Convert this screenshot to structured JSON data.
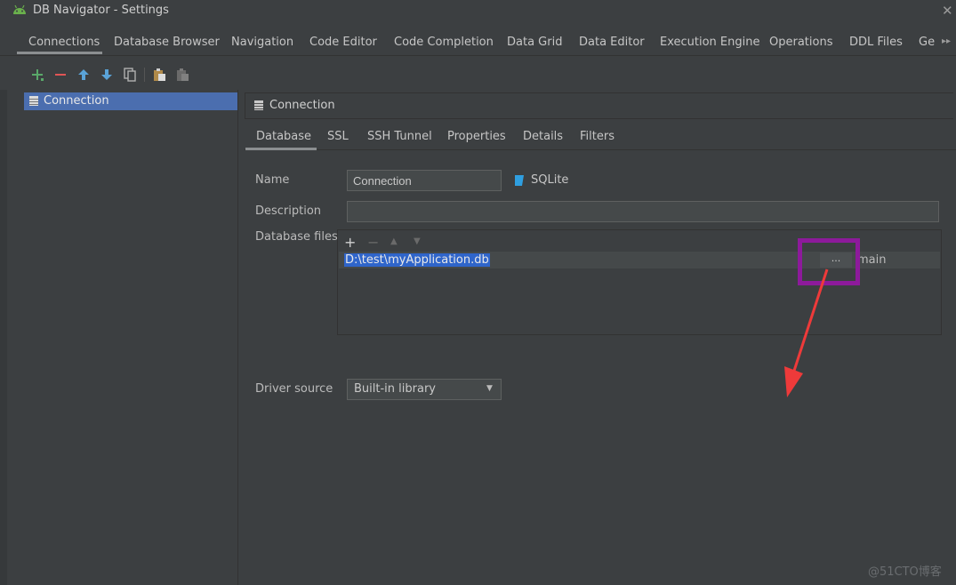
{
  "window": {
    "title": "DB Navigator - Settings"
  },
  "top_tabs": [
    {
      "label": "Connections"
    },
    {
      "label": "Database Browser"
    },
    {
      "label": "Navigation"
    },
    {
      "label": "Code Editor"
    },
    {
      "label": "Code Completion"
    },
    {
      "label": "Data Grid"
    },
    {
      "label": "Data Editor"
    },
    {
      "label": "Execution Engine"
    },
    {
      "label": "Operations"
    },
    {
      "label": "DDL Files"
    },
    {
      "label": "Ge"
    }
  ],
  "selected_top_tab": "Connections",
  "toolbar": {
    "icons": [
      "add-icon",
      "remove-icon",
      "move-up-icon",
      "move-down-icon",
      "copy-icon",
      "paste-icon",
      "delete-icon"
    ]
  },
  "connections": [
    {
      "label": "Connection"
    }
  ],
  "panel": {
    "title": "Connection",
    "sub_tabs": [
      {
        "label": "Database"
      },
      {
        "label": "SSL"
      },
      {
        "label": "SSH Tunnel"
      },
      {
        "label": "Properties"
      },
      {
        "label": "Details"
      },
      {
        "label": "Filters"
      }
    ],
    "selected_sub_tab": "Database"
  },
  "form": {
    "name_label": "Name",
    "name_value": "Connection",
    "db_type": "SQLite",
    "description_label": "Description",
    "description_value": "",
    "database_files_label": "Database files",
    "file_path": "D:\\test\\myApplication.db",
    "browse_label": "...",
    "schema_name": "main",
    "driver_source_label": "Driver source",
    "driver_source_value": "Built-in library"
  },
  "annotation": {
    "highlight_color": "#8d1a9b",
    "arrow_color": "#ee3a3a"
  },
  "watermark": "@51CTO博客",
  "colors": {
    "selection": "#4b6eaf",
    "text_selection": "#2f65ca",
    "background": "#3c3f41"
  }
}
